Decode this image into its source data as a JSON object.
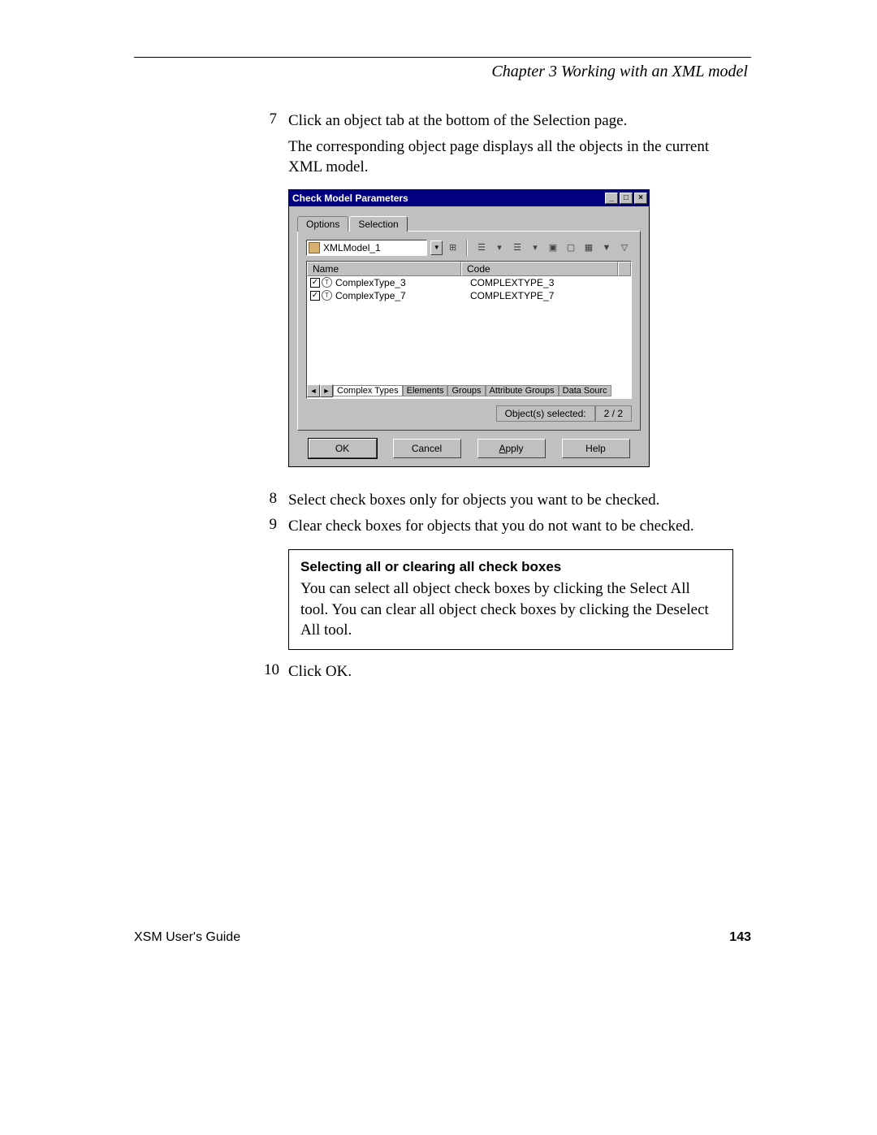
{
  "header": {
    "chapter_label": "Chapter 3    Working with an XML model"
  },
  "steps": {
    "s7_num": "7",
    "s7_text": "Click an object tab at the bottom of the Selection page.",
    "s7_cont": "The corresponding object page displays all the objects in the current XML model.",
    "s8_num": "8",
    "s8_text": "Select check boxes only for objects you want to be checked.",
    "s9_num": "9",
    "s9_text": "Clear check boxes for objects that you do not want to be checked.",
    "s10_num": "10",
    "s10_text": "Click OK."
  },
  "dialog": {
    "title": "Check Model Parameters",
    "tabs": {
      "options": "Options",
      "selection": "Selection"
    },
    "model_value": "XMLModel_1",
    "columns": {
      "name": "Name",
      "code": "Code"
    },
    "rows": [
      {
        "name": "ComplexType_3",
        "code": "COMPLEXTYPE_3",
        "checked": true
      },
      {
        "name": "ComplexType_7",
        "code": "COMPLEXTYPE_7",
        "checked": true
      }
    ],
    "bottom_tabs": {
      "t1": "Complex Types",
      "t2": "Elements",
      "t3": "Groups",
      "t4": "Attribute Groups",
      "t5": "Data Sourc"
    },
    "status": {
      "label": "Object(s) selected:",
      "count": "2 / 2"
    },
    "buttons": {
      "ok": "OK",
      "cancel": "Cancel",
      "apply": "Apply",
      "help": "Help"
    }
  },
  "callout": {
    "title": "Selecting all or clearing all check boxes",
    "body": "You can select all object check boxes by clicking the Select All tool. You can clear all object check boxes by clicking the Deselect All tool."
  },
  "footer": {
    "guide": "XSM User's Guide",
    "page": "143"
  }
}
